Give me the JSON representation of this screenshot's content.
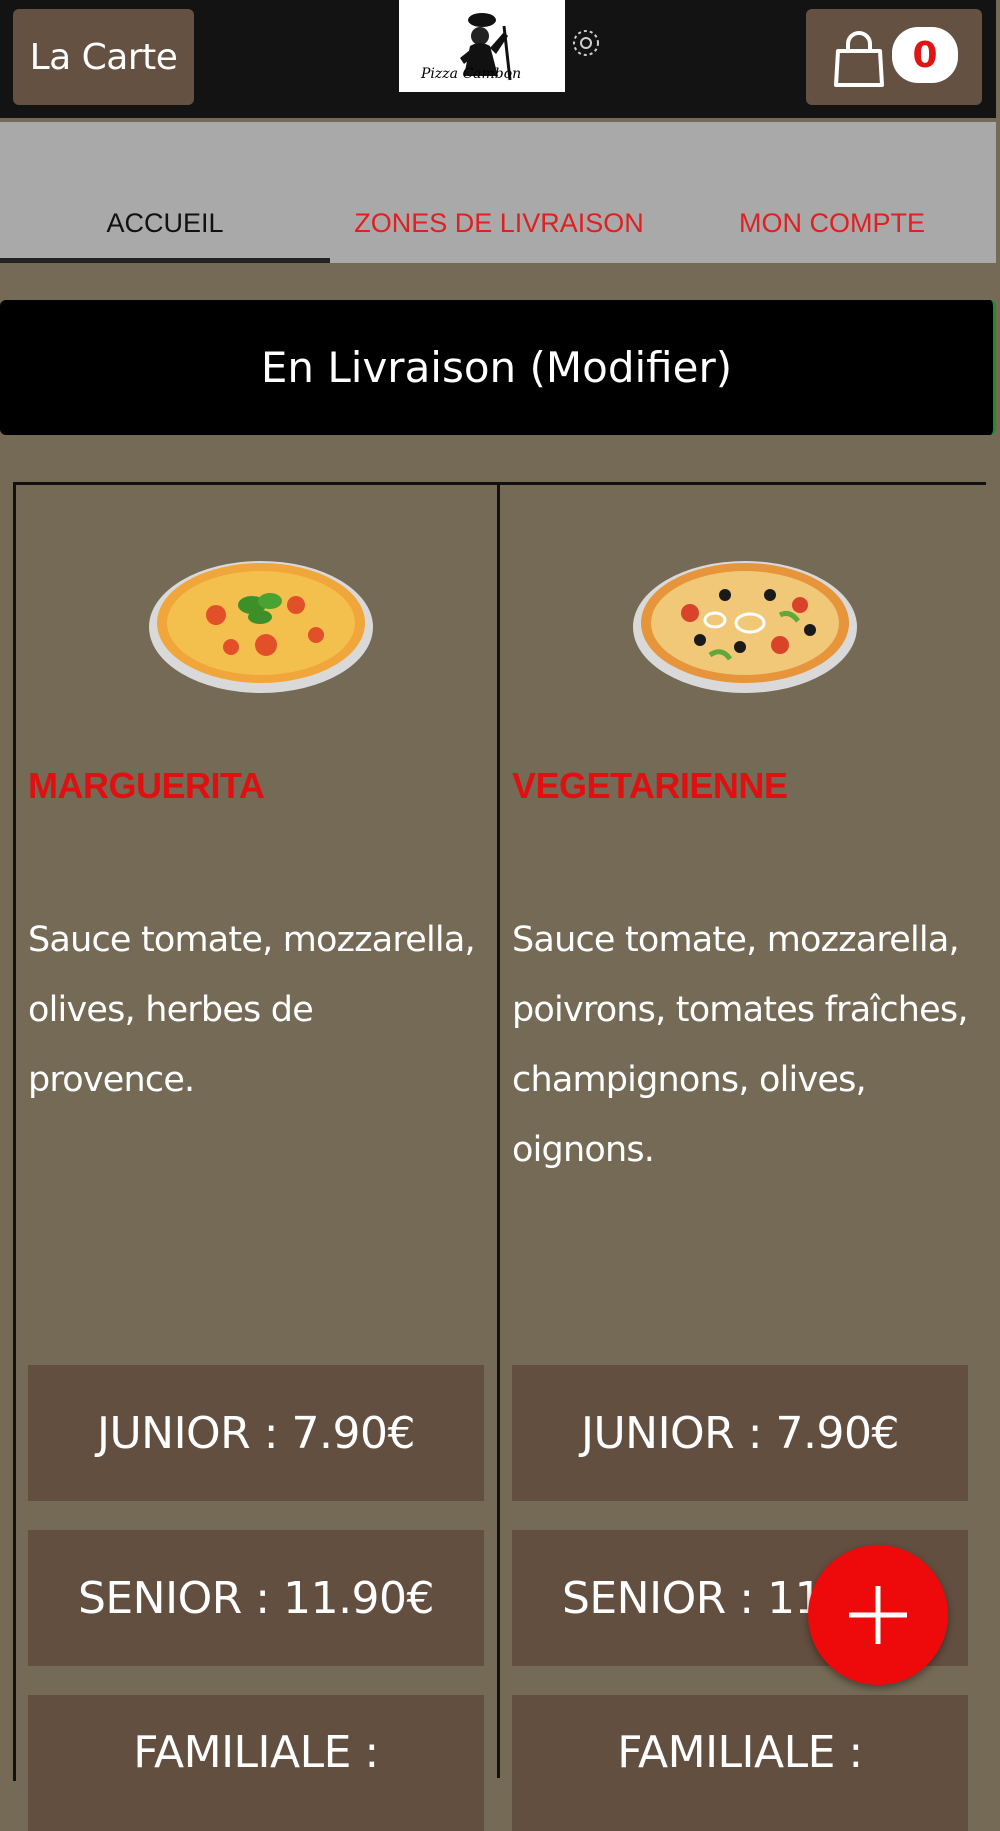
{
  "header": {
    "menu_label": "La Carte",
    "logo_text": "Pizza Cambon",
    "cart_count": "0"
  },
  "tabs": [
    {
      "label": "ACCUEIL",
      "active": true
    },
    {
      "label": "ZONES DE LIVRAISON",
      "active": false
    },
    {
      "label": "MON COMPTE",
      "active": false
    }
  ],
  "delivery": {
    "label": "En Livraison (Modifier)"
  },
  "products": [
    {
      "name": "MARGUERITA",
      "description": "Sauce tomate, mozzarella, olives, herbes de provence.",
      "prices": [
        "JUNIOR : 7.90€",
        "SENIOR : 11.90€",
        "FAMILIALE :"
      ]
    },
    {
      "name": "VEGETARIENNE",
      "description": "Sauce tomate, mozzarella, poivrons, tomates fraîches, champignons, olives, oignons.",
      "prices": [
        "JUNIOR : 7.90€",
        "SENIOR : 11.90€",
        "FAMILIALE :"
      ]
    }
  ],
  "fab": {
    "icon": "plus-icon"
  },
  "colors": {
    "topbar": "#131313",
    "button_brown": "#655141",
    "accent_red": "#e01010",
    "background": "#756a55",
    "fab_red": "#ee0a0a"
  }
}
